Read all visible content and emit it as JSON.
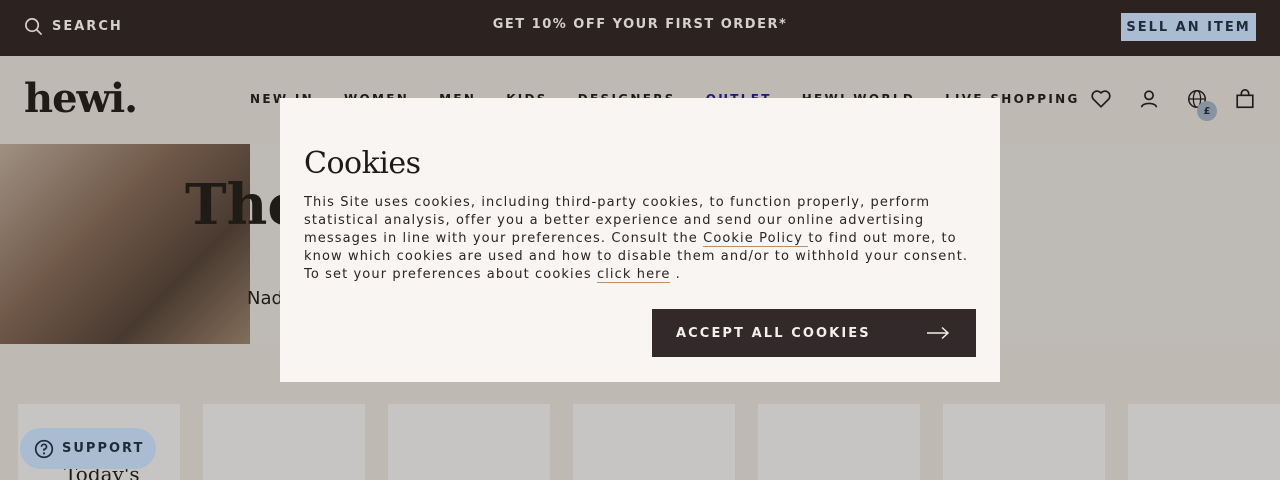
{
  "topbar": {
    "search_label": "SEARCH",
    "promo": "GET 10% OFF YOUR FIRST ORDER*",
    "sell_label": "SELL AN ITEM"
  },
  "header": {
    "logo": "hewi.",
    "nav": [
      "NEW IN",
      "WOMEN",
      "MEN",
      "KIDS",
      "DESIGNERS",
      "OUTLET",
      "HEWI WORLD",
      "LIVE SHOPPING"
    ],
    "currency_badge": "£",
    "icons": [
      "heart-icon",
      "user-icon",
      "globe-icon",
      "bag-icon"
    ]
  },
  "hero": {
    "title": "The",
    "subtitle": "Nad"
  },
  "products": {
    "today_label": "Today's"
  },
  "support": {
    "label": "SUPPORT"
  },
  "cookies": {
    "title": "Cookies",
    "text_1": "This Site uses cookies, including third-party cookies, to function properly, perform statistical analysis, offer you a better experience and send our online advertising messages in line with your preferences. Consult the ",
    "policy_link": "Cookie Policy ",
    "text_2": "to find out more, to know which cookies are used and how to disable them and/or to withhold your consent. To set your preferences about cookies ",
    "click_link": "click here",
    "text_3": " .",
    "accept_label": "ACCEPT ALL COOKIES"
  },
  "colors": {
    "dark": "#2c2321",
    "accent_blue": "#a9bcd2",
    "outlet_link": "#1a1a8c",
    "button_dark": "#33282a",
    "link_underline": "#b98e68"
  }
}
